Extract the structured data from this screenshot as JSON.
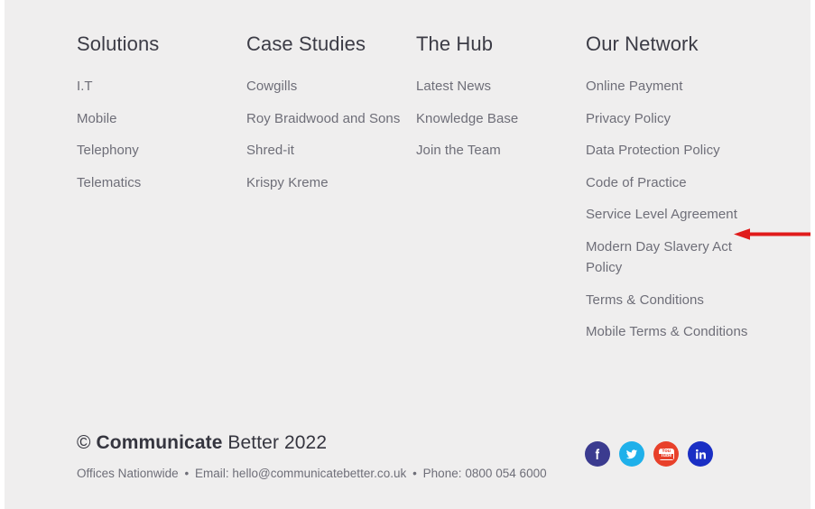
{
  "footer": {
    "columns": [
      {
        "title": "Solutions",
        "name": "solutions",
        "links": [
          "I.T",
          "Mobile",
          "Telephony",
          "Telematics"
        ]
      },
      {
        "title": "Case Studies",
        "name": "case-studies",
        "links": [
          "Cowgills",
          "Roy Braidwood and Sons",
          "Shred-it",
          "Krispy Kreme"
        ]
      },
      {
        "title": "The Hub",
        "name": "the-hub",
        "links": [
          "Latest News",
          "Knowledge Base",
          "Join the Team"
        ]
      },
      {
        "title": "Our Network",
        "name": "our-network",
        "links": [
          "Online Payment",
          "Privacy Policy",
          "Data Protection Policy",
          "Code of Practice",
          "Service Level Agreement",
          "Modern Day Slavery Act Policy",
          "Terms & Conditions",
          "Mobile Terms & Conditions"
        ]
      }
    ],
    "copyright": {
      "symbol": "©",
      "brand": "Communicate",
      "rest": "Better 2022",
      "full": "© Communicate Better 2022"
    },
    "contact": {
      "offices": "Offices Nationwide",
      "separator": "•",
      "email_label": "Email:",
      "email": "hello@communicatebetter.co.uk",
      "phone_label": "Phone:",
      "phone": "0800 054 6000"
    },
    "social": [
      {
        "name": "facebook",
        "label": "Facebook",
        "icon": "facebook-icon",
        "color": "#3b3b8f"
      },
      {
        "name": "twitter",
        "label": "Twitter",
        "icon": "twitter-icon",
        "color": "#1fb0ea"
      },
      {
        "name": "youtube",
        "label": "YouTube",
        "icon": "youtube-icon",
        "color": "#e8402a",
        "glyph_top": "You",
        "glyph_bottom": "Tube"
      },
      {
        "name": "linkedin",
        "label": "LinkedIn",
        "icon": "linkedin-icon",
        "color": "#1a2fc4",
        "glyph": "in"
      }
    ],
    "annotation": {
      "type": "arrow",
      "direction": "left",
      "color": "#e01b1b",
      "points_at": "Service Level Agreement"
    },
    "colors": {
      "background": "#efeeee",
      "heading_text": "#3c3c46",
      "link_text": "#6e6e78",
      "copyright_text": "#35353f"
    }
  }
}
